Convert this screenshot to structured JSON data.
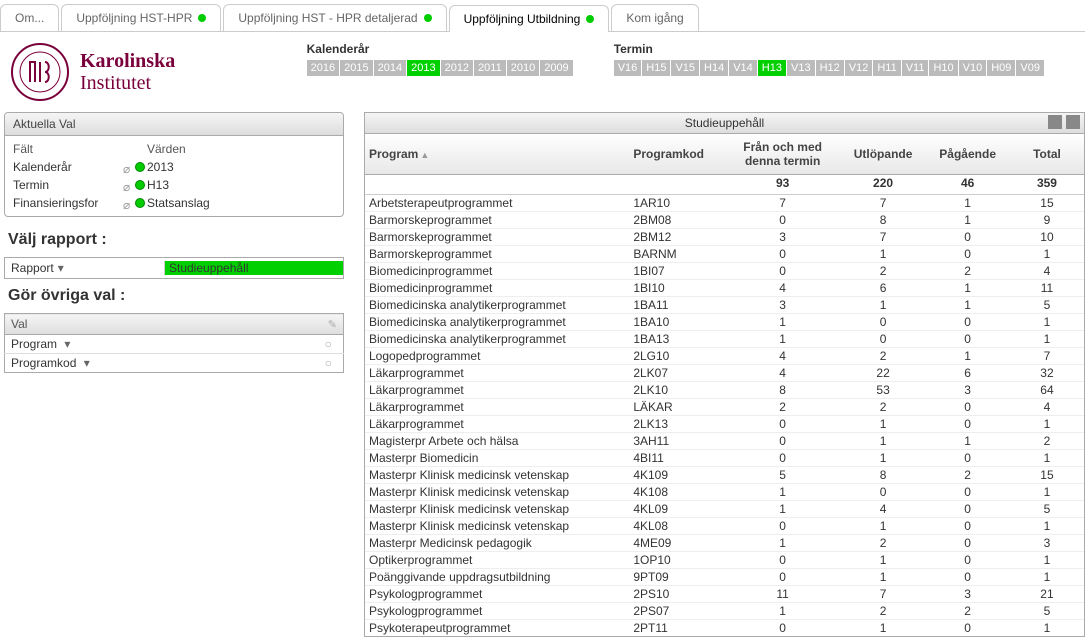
{
  "tabs": [
    {
      "label": "Om...",
      "active": false,
      "dot": false
    },
    {
      "label": "Uppföljning HST-HPR",
      "active": false,
      "dot": true
    },
    {
      "label": "Uppföljning HST - HPR detaljerad",
      "active": false,
      "dot": true
    },
    {
      "label": "Uppföljning Utbildning",
      "active": true,
      "dot": true
    },
    {
      "label": "Kom igång",
      "active": false,
      "dot": false
    }
  ],
  "logo": {
    "line1": "Karolinska",
    "line2": "Institutet"
  },
  "filters": {
    "kalenderar_label": "Kalenderår",
    "termin_label": "Termin",
    "years": [
      "2016",
      "2015",
      "2014",
      "2013",
      "2012",
      "2011",
      "2010",
      "2009"
    ],
    "year_selected": "2013",
    "terms": [
      "V16",
      "H15",
      "V15",
      "H14",
      "V14",
      "H13",
      "V13",
      "H12",
      "V12",
      "H11",
      "V11",
      "H10",
      "V10",
      "H09",
      "V09"
    ],
    "term_selected": "H13"
  },
  "aktuella": {
    "title": "Aktuella Val",
    "header_falt": "Fält",
    "header_varden": "Värden",
    "rows": [
      {
        "k": "Kalenderår",
        "v": "2013"
      },
      {
        "k": "Termin",
        "v": "H13"
      },
      {
        "k": "Finansieringsfor",
        "v": "Statsanslag"
      }
    ]
  },
  "valj_rapport": {
    "heading": "Välj rapport :",
    "label": "Rapport",
    "value": "Studieuppehåll"
  },
  "gor_ovriga": {
    "heading": "Gör övriga val :",
    "title": "Val",
    "rows": [
      "Program",
      "Programkod"
    ]
  },
  "chart_data": {
    "type": "table",
    "title": "Studieuppehåll",
    "columns": [
      "Program",
      "Programkod",
      "Från och med denna termin",
      "Utlöpande",
      "Pågående",
      "Total"
    ],
    "totals": {
      "fran": 93,
      "utl": 220,
      "pag": 46,
      "tot": 359
    },
    "rows": [
      {
        "program": "Arbetsterapeutprogrammet",
        "kod": "1AR10",
        "fran": 7,
        "utl": 7,
        "pag": 1,
        "tot": 15
      },
      {
        "program": "Barmorskeprogrammet",
        "kod": "2BM08",
        "fran": 0,
        "utl": 8,
        "pag": 1,
        "tot": 9
      },
      {
        "program": "Barmorskeprogrammet",
        "kod": "2BM12",
        "fran": 3,
        "utl": 7,
        "pag": 0,
        "tot": 10
      },
      {
        "program": "Barmorskeprogrammet",
        "kod": "BARNM",
        "fran": 0,
        "utl": 1,
        "pag": 0,
        "tot": 1
      },
      {
        "program": "Biomedicinprogrammet",
        "kod": "1BI07",
        "fran": 0,
        "utl": 2,
        "pag": 2,
        "tot": 4
      },
      {
        "program": "Biomedicinprogrammet",
        "kod": "1BI10",
        "fran": 4,
        "utl": 6,
        "pag": 1,
        "tot": 11
      },
      {
        "program": "Biomedicinska analytikerprogrammet",
        "kod": "1BA11",
        "fran": 3,
        "utl": 1,
        "pag": 1,
        "tot": 5
      },
      {
        "program": "Biomedicinska analytikerprogrammet",
        "kod": "1BA10",
        "fran": 1,
        "utl": 0,
        "pag": 0,
        "tot": 1
      },
      {
        "program": "Biomedicinska analytikerprogrammet",
        "kod": "1BA13",
        "fran": 1,
        "utl": 0,
        "pag": 0,
        "tot": 1
      },
      {
        "program": "Logopedprogrammet",
        "kod": "2LG10",
        "fran": 4,
        "utl": 2,
        "pag": 1,
        "tot": 7
      },
      {
        "program": "Läkarprogrammet",
        "kod": "2LK07",
        "fran": 4,
        "utl": 22,
        "pag": 6,
        "tot": 32
      },
      {
        "program": "Läkarprogrammet",
        "kod": "2LK10",
        "fran": 8,
        "utl": 53,
        "pag": 3,
        "tot": 64
      },
      {
        "program": "Läkarprogrammet",
        "kod": "LÄKAR",
        "fran": 2,
        "utl": 2,
        "pag": 0,
        "tot": 4
      },
      {
        "program": "Läkarprogrammet",
        "kod": "2LK13",
        "fran": 0,
        "utl": 1,
        "pag": 0,
        "tot": 1
      },
      {
        "program": "Magisterpr Arbete och hälsa",
        "kod": "3AH11",
        "fran": 0,
        "utl": 1,
        "pag": 1,
        "tot": 2
      },
      {
        "program": "Masterpr Biomedicin",
        "kod": "4BI11",
        "fran": 0,
        "utl": 1,
        "pag": 0,
        "tot": 1
      },
      {
        "program": "Masterpr Klinisk medicinsk vetenskap",
        "kod": "4K109",
        "fran": 5,
        "utl": 8,
        "pag": 2,
        "tot": 15
      },
      {
        "program": "Masterpr Klinisk medicinsk vetenskap",
        "kod": "4K108",
        "fran": 1,
        "utl": 0,
        "pag": 0,
        "tot": 1
      },
      {
        "program": "Masterpr Klinisk medicinsk vetenskap",
        "kod": "4KL09",
        "fran": 1,
        "utl": 4,
        "pag": 0,
        "tot": 5
      },
      {
        "program": "Masterpr Klinisk medicinsk vetenskap",
        "kod": "4KL08",
        "fran": 0,
        "utl": 1,
        "pag": 0,
        "tot": 1
      },
      {
        "program": "Masterpr Medicinsk pedagogik",
        "kod": "4ME09",
        "fran": 1,
        "utl": 2,
        "pag": 0,
        "tot": 3
      },
      {
        "program": "Optikerprogrammet",
        "kod": "1OP10",
        "fran": 0,
        "utl": 1,
        "pag": 0,
        "tot": 1
      },
      {
        "program": "Poänggivande uppdragsutbildning",
        "kod": "9PT09",
        "fran": 0,
        "utl": 1,
        "pag": 0,
        "tot": 1
      },
      {
        "program": "Psykologprogrammet",
        "kod": "2PS10",
        "fran": 11,
        "utl": 7,
        "pag": 3,
        "tot": 21
      },
      {
        "program": "Psykologprogrammet",
        "kod": "2PS07",
        "fran": 1,
        "utl": 2,
        "pag": 2,
        "tot": 5
      },
      {
        "program": "Psykoterapeutprogrammet",
        "kod": "2PT11",
        "fran": 0,
        "utl": 1,
        "pag": 0,
        "tot": 1
      }
    ]
  }
}
